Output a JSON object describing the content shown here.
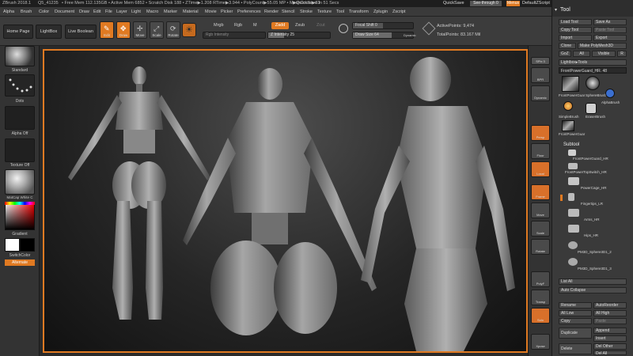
{
  "title_bar": {
    "app": "ZBrush 2018.1",
    "file": "Q5_41235",
    "stats": "• Free Mem 112.135GB • Active Mem 6852 • Scratch Disk 188 • ZTime▶1.208 RTime▶3.944 • PolyCount▶55.05 MP • MeshCount▶33",
    "quicksave_timer": "▶QuickSave In 51 Secs",
    "quicksave": "QuickSave",
    "see_through": "See-through 0",
    "menus_btn": "Menus",
    "zscript": "DefaultZScript"
  },
  "menu": [
    "Alpha",
    "Brush",
    "Color",
    "Document",
    "Draw",
    "Edit",
    "File",
    "Layer",
    "Light",
    "Macro",
    "Marker",
    "Material",
    "Movie",
    "Picker",
    "Preferences",
    "Render",
    "Stencil",
    "Stroke",
    "Texture",
    "Tool",
    "Transform",
    "Zplugin",
    "Zscript"
  ],
  "top_shelf": {
    "home_page": "Home Page",
    "lightbox": "LightBox",
    "live_boolean": "Live Boolean",
    "edit": "Edit",
    "draw": "Draw",
    "move": "Move",
    "scale": "Scale",
    "rotate": "Rotate",
    "mrgb": "Mrgb",
    "rgb": "Rgb",
    "m": "M",
    "zadd": "Zadd",
    "zsub": "Zsub",
    "zcut": "Zcut",
    "rgb_intensity": "Rgb Intensity",
    "z_intensity": "Z Intensity 25",
    "z_intensity_value": 25,
    "focal_shift": "Focal Shift 0",
    "draw_size": "Draw Size 64",
    "draw_size_value": 64,
    "dynamic": "Dynamic",
    "active_points": "ActivePoints: 9,474",
    "total_points": "TotalPoints: 83.167 Mil"
  },
  "left_tray": {
    "brush": "Standard",
    "stroke": "Dots",
    "alpha": "Alpha Off",
    "texture": "Texture Off",
    "material": "MatCap White C",
    "gradient": "Gradient",
    "switch_color": "SwitchColor",
    "alternate": "Alternate"
  },
  "right_shelf": [
    "SPix 3",
    "BPR",
    "Dynamic",
    "Persp",
    "Floor",
    "Local",
    "Frame",
    "Move",
    "Scale",
    "Rotate",
    "PolyF",
    "Transp",
    "Solo",
    "Xpose"
  ],
  "tool_panel": {
    "title": "Tool",
    "load_tool": "Load Tool",
    "save_as": "Save As",
    "copy_tool": "Copy Tool",
    "paste_tool": "Paste Tool",
    "import": "Import",
    "export": "Export",
    "clone": "Clone",
    "make_polymesh": "Make PolyMesh3D",
    "goz": "GoZ",
    "all": "All",
    "visible": "Visible",
    "r": "R",
    "lightbox_tools": "Lightbox▸Tools",
    "current_tool": "FrontPowerGuard_HR. 48",
    "tools": [
      "FrontPowerGuar",
      "SphereBrush",
      "AlphaBrush",
      "SimpleBrush",
      "EraserBrush",
      "FrontPowerGuar"
    ],
    "subtool_title": "Subtool",
    "subtools": [
      "FrontPowerGuard_HR",
      "FrontPowerTopSwitch_HR",
      "PowerCage_HR",
      "Fingertips_LR",
      "Arms_HR",
      "Hips_HR",
      "PM3D_Sphere3D1_2",
      "PM3D_Sphere3D1_3"
    ],
    "list_all": "List All",
    "auto_collapse": "Auto Collapse",
    "rename": "Rename",
    "auto_reorder": "AutoReorder",
    "all_low": "All Low",
    "all_high": "All High",
    "copy": "Copy",
    "paste": "Paste",
    "duplicate": "Duplicate",
    "append": "Append",
    "insert": "Insert",
    "delete": "Delete",
    "del_other": "Del Other",
    "del_all": "Del All"
  },
  "colors": {
    "accent": "#e07a22",
    "panel": "#3a3a3a",
    "canvas_bg": "#1c1c1c"
  }
}
